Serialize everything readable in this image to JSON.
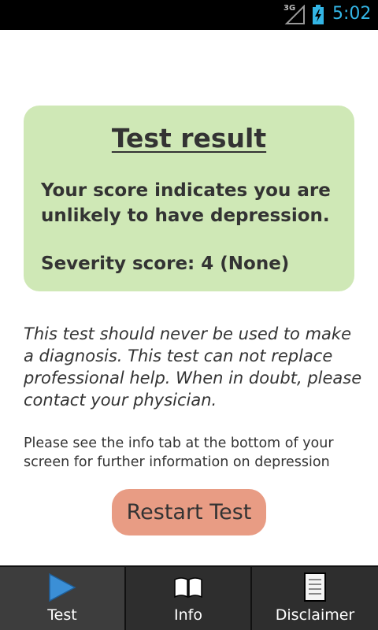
{
  "status_bar": {
    "network": "3G",
    "time": "5:02"
  },
  "result": {
    "title": "Test result",
    "message": "Your score indicates you are unlikely to have depression.",
    "severity": "Severity score: 4 (None)"
  },
  "disclaimer_text": "This test should never be used to make a diagnosis. This test can not replace professional help. When in doubt, please contact your physician.",
  "info_hint": "Please see the info tab at the bottom of your screen for further information on depression",
  "restart_button": "Restart Test",
  "tabs": [
    {
      "label": "Test",
      "icon": "play-icon",
      "active": true
    },
    {
      "label": "Info",
      "icon": "book-icon",
      "active": false
    },
    {
      "label": "Disclaimer",
      "icon": "document-icon",
      "active": false
    }
  ],
  "colors": {
    "card_background": "#cfe8b6",
    "button_background": "#e89c84",
    "status_accent": "#33b5e5",
    "play_icon": "#3b8fd6"
  }
}
